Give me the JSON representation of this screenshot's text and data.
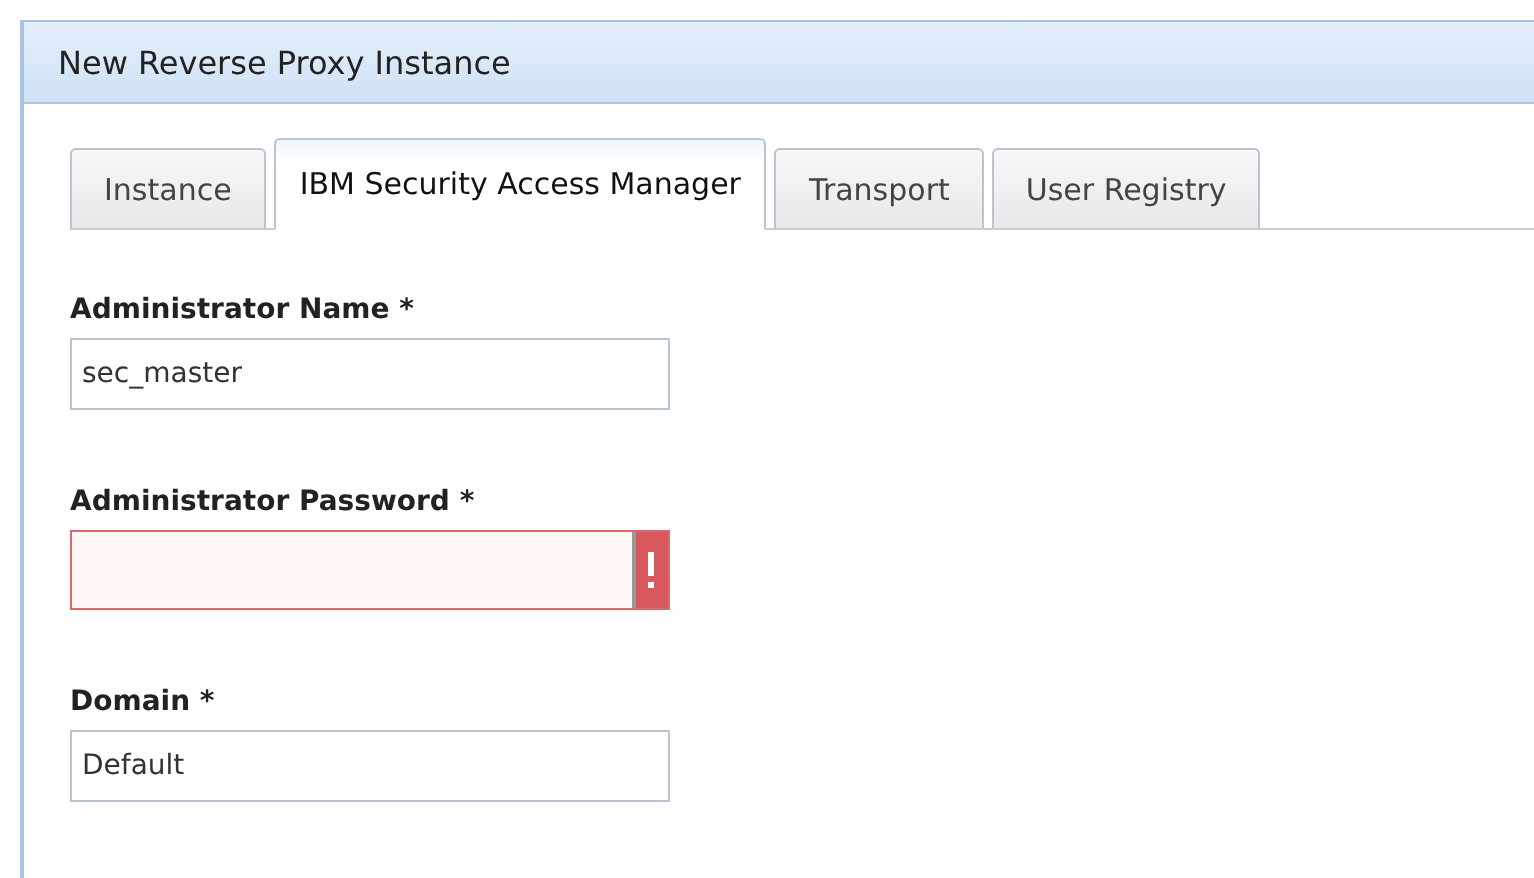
{
  "dialog": {
    "title": "New Reverse Proxy Instance"
  },
  "tabs": [
    {
      "label": "Instance",
      "selected": false
    },
    {
      "label": "IBM Security Access Manager",
      "selected": true
    },
    {
      "label": "Transport",
      "selected": false
    },
    {
      "label": "User Registry",
      "selected": false
    }
  ],
  "fields": [
    {
      "label": "Administrator Name *",
      "value": "sec_master",
      "invalid": false
    },
    {
      "label": "Administrator Password *",
      "invalid": true
    },
    {
      "label": "Domain *",
      "value": "Default",
      "invalid": false
    }
  ]
}
